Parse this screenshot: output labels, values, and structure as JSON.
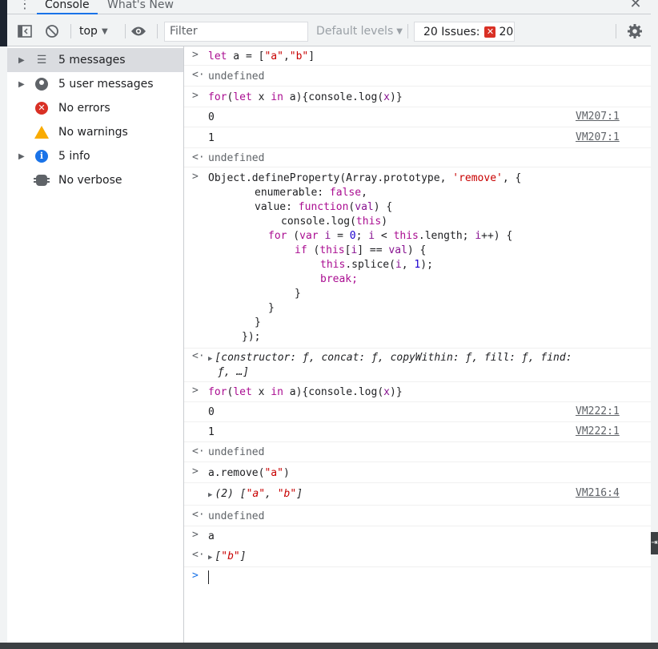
{
  "tabs": {
    "menu_icon": "⋮",
    "console": "Console",
    "whats_new": "What's New",
    "close": "✕"
  },
  "toolbar": {
    "context": "top",
    "filter_placeholder": "Filter",
    "levels": "Default levels",
    "issues_label": "20 Issues:",
    "issues_count": "20"
  },
  "sidebar": {
    "items": [
      {
        "label": "5 messages",
        "icon": "list-icon"
      },
      {
        "label": "5 user messages",
        "icon": "user-icon"
      },
      {
        "label": "No errors",
        "icon": "error-icon"
      },
      {
        "label": "No warnings",
        "icon": "warning-icon"
      },
      {
        "label": "5 info",
        "icon": "info-icon"
      },
      {
        "label": "No verbose",
        "icon": "bug-icon"
      }
    ]
  },
  "console": {
    "l1": "let a = [\"a\",\"b\"]",
    "undefined": "undefined",
    "for_loop": "for(let x in a){console.log(x)}",
    "zero": "0",
    "one": "1",
    "vm207": "VM207:1",
    "def1": "Object.defineProperty(Array.prototype, 'remove', {",
    "def2": "enumerable: false,",
    "def3": "value: function(val) {",
    "def4": "console.log(this)",
    "def5": "for (var i = 0; i < this.length; i++) {",
    "def6": "if (this[i] == val) {",
    "def7": "this.splice(i, 1);",
    "def8": "break;",
    "def9": "}",
    "def10": "}",
    "def11": "}",
    "def12": "});",
    "proto1": "[constructor: ƒ, concat: ƒ, copyWithin: ƒ, fill: ƒ, find:",
    "proto2": "ƒ, …]",
    "vm222": "VM222:1",
    "remove_call": "a.remove(\"a\")",
    "log_arr": "(2) [\"a\", \"b\"]",
    "vm216": "VM216:4",
    "a": "a",
    "result_arr": "[\"b\"]"
  },
  "colors": {
    "accent": "#1a73e8",
    "error": "#d93025",
    "warning": "#f9ab00",
    "string": "#c80000",
    "keyword": "#aa0d91"
  }
}
